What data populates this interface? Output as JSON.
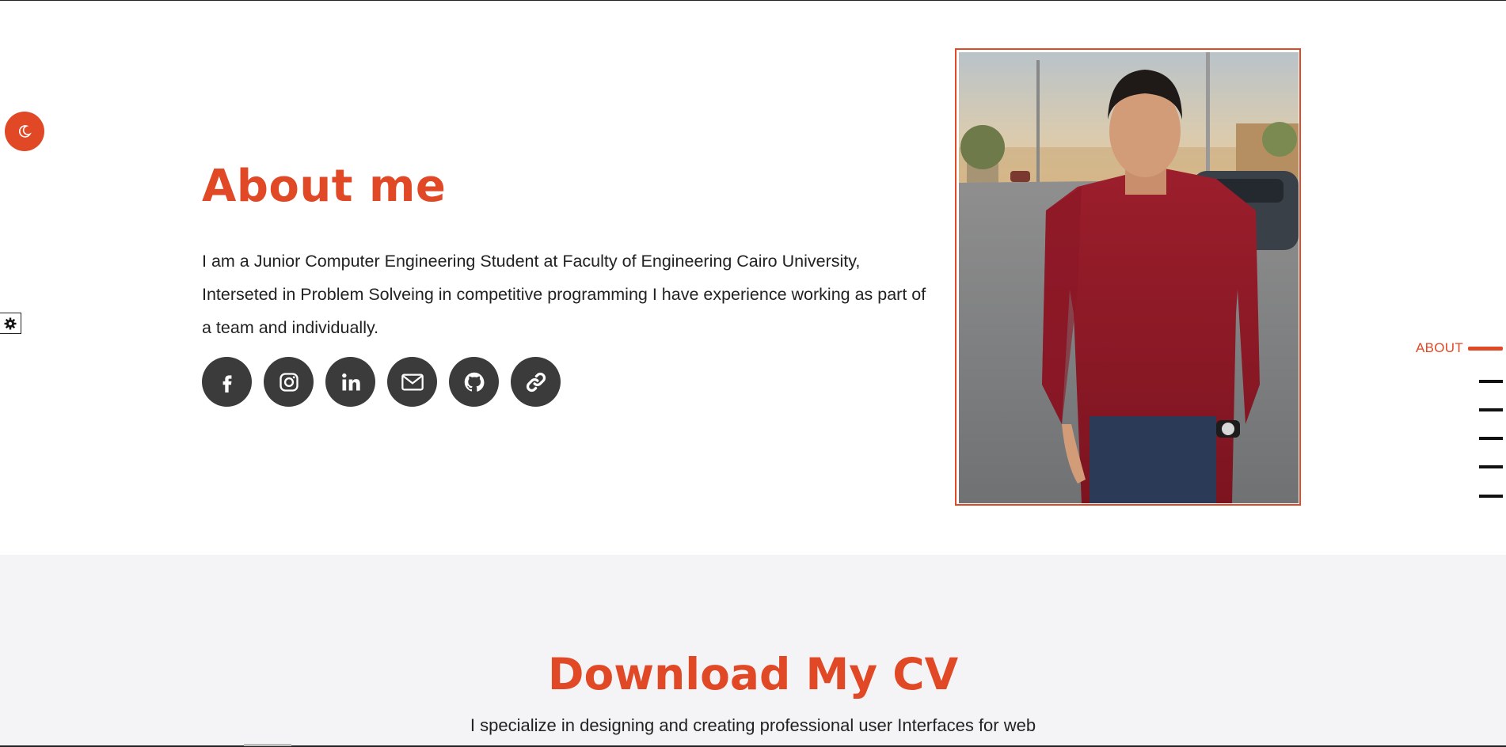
{
  "about": {
    "title": "About me",
    "text": "I am a Junior Computer Engineering Student at Faculty of Engineering Cairo University, Interseted in Problem Solveing in competitive programming I have experience working as part of a team and individually.",
    "social": [
      {
        "name": "facebook-icon"
      },
      {
        "name": "instagram-icon"
      },
      {
        "name": "linkedin-icon"
      },
      {
        "name": "email-icon"
      },
      {
        "name": "github-icon"
      },
      {
        "name": "link-icon"
      }
    ]
  },
  "side_nav": {
    "active_label": "ABOUT",
    "dash_count": 5
  },
  "cv": {
    "title": "Download My CV",
    "subtitle": "I specialize in designing and creating professional user Interfaces for web"
  },
  "colors": {
    "accent": "#e04826",
    "icon_bg": "#3b3b3b",
    "section_alt_bg": "#f4f4f6"
  },
  "icons": {
    "theme_toggle": "moon-icon",
    "settings": "gear-icon"
  }
}
